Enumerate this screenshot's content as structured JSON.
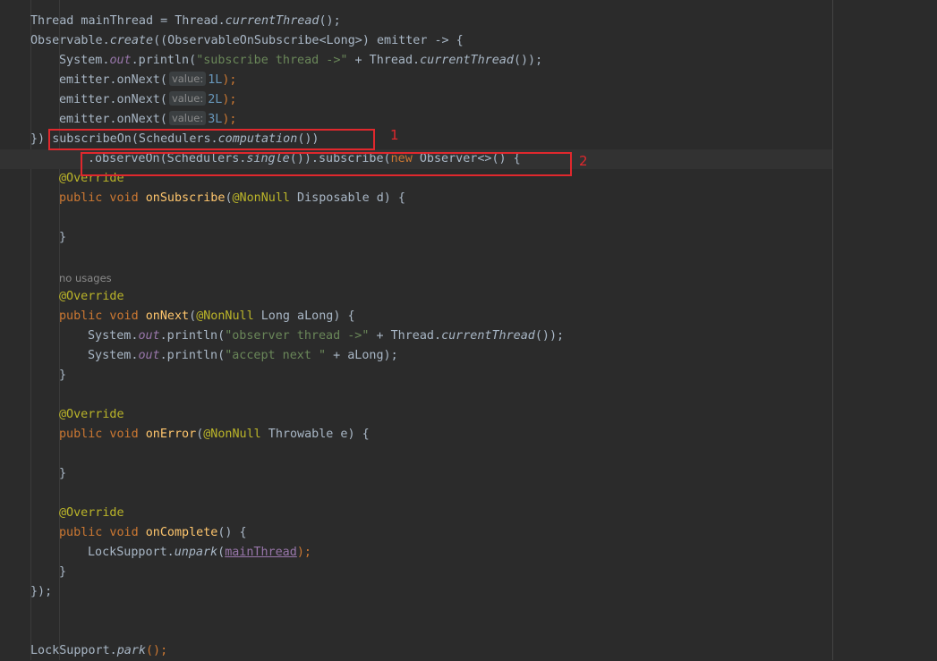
{
  "editor": {
    "hints": {
      "value": "value:"
    },
    "inlays": {
      "no_usages": "no usages"
    },
    "annotations": {
      "box1_label": "1",
      "box2_label": "2"
    },
    "lines": {
      "l1": [
        "Thread mainThread = Thread.",
        "currentThread",
        "();"
      ],
      "l2": [
        "Observable.",
        "create",
        "((ObservableOnSubscribe<Long>) emitter -> {"
      ],
      "l3": [
        "System.",
        "out",
        ".println(",
        "\"subscribe thread ->\"",
        " + Thread.",
        "currentThread",
        "());"
      ],
      "l4": [
        "emitter.onNext(",
        "1L",
        ");"
      ],
      "l5": [
        "emitter.onNext(",
        "2L",
        ");"
      ],
      "l6": [
        "emitter.onNext(",
        "3L",
        ");"
      ],
      "l7": [
        "}) ",
        "subscribeOn(Schedulers.",
        "computation",
        "())"
      ],
      "l8": [
        ".observeOn(Schedulers.",
        "single",
        "()).subscribe(",
        "new",
        " Observer<>() {"
      ],
      "l9": [
        "@Override"
      ],
      "l10": [
        "public void ",
        "onSubscribe",
        "(",
        "@NonNull",
        " Disposable d) {"
      ],
      "l11": [
        "}"
      ],
      "l12": [
        "@Override"
      ],
      "l13": [
        "public void ",
        "onNext",
        "(",
        "@NonNull",
        " Long aLong) {"
      ],
      "l14": [
        "System.",
        "out",
        ".println(",
        "\"observer thread ->\"",
        " + Thread.",
        "currentThread",
        "());"
      ],
      "l15": [
        "System.",
        "out",
        ".println(",
        "\"accept next \"",
        " + aLong);"
      ],
      "l16": [
        "}"
      ],
      "l17": [
        "@Override"
      ],
      "l18": [
        "public void ",
        "onError",
        "(",
        "@NonNull",
        " Throwable e) {"
      ],
      "l19": [
        "}"
      ],
      "l20": [
        "@Override"
      ],
      "l21": [
        "public void ",
        "onComplete",
        "() {"
      ],
      "l22": [
        "LockSupport.",
        "unpark",
        "(",
        "mainThread",
        ");"
      ],
      "l23": [
        "}"
      ],
      "l24": [
        "});"
      ],
      "l25": [
        "LockSupport.",
        "park",
        "();"
      ]
    }
  },
  "colors": {
    "background": "#2b2b2b",
    "text": "#a9b7c6",
    "keyword": "#cc7832",
    "string": "#6a8759",
    "number": "#6897bb",
    "annotation": "#bbb529",
    "static_field": "#9876aa",
    "method_declaration": "#ffc66d",
    "highlight_box": "#e0282d"
  }
}
